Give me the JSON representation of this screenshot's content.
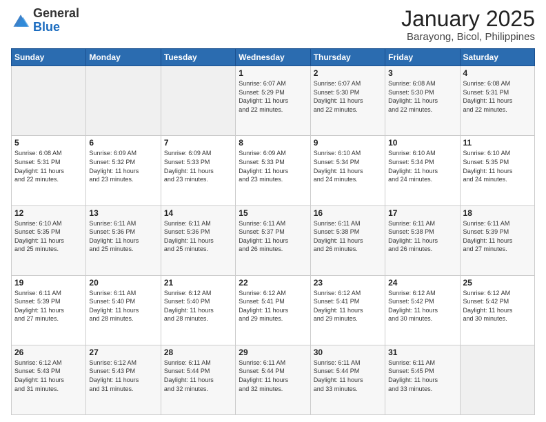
{
  "header": {
    "logo_general": "General",
    "logo_blue": "Blue",
    "month_year": "January 2025",
    "location": "Barayong, Bicol, Philippines"
  },
  "days_of_week": [
    "Sunday",
    "Monday",
    "Tuesday",
    "Wednesday",
    "Thursday",
    "Friday",
    "Saturday"
  ],
  "weeks": [
    [
      {
        "day": "",
        "sunrise": "",
        "sunset": "",
        "daylight": ""
      },
      {
        "day": "",
        "sunrise": "",
        "sunset": "",
        "daylight": ""
      },
      {
        "day": "",
        "sunrise": "",
        "sunset": "",
        "daylight": ""
      },
      {
        "day": "1",
        "sunrise": "6:07 AM",
        "sunset": "5:29 PM",
        "daylight1": "11 hours",
        "daylight2": "and 22 minutes."
      },
      {
        "day": "2",
        "sunrise": "6:07 AM",
        "sunset": "5:30 PM",
        "daylight1": "11 hours",
        "daylight2": "and 22 minutes."
      },
      {
        "day": "3",
        "sunrise": "6:08 AM",
        "sunset": "5:30 PM",
        "daylight1": "11 hours",
        "daylight2": "and 22 minutes."
      },
      {
        "day": "4",
        "sunrise": "6:08 AM",
        "sunset": "5:31 PM",
        "daylight1": "11 hours",
        "daylight2": "and 22 minutes."
      }
    ],
    [
      {
        "day": "5",
        "sunrise": "6:08 AM",
        "sunset": "5:31 PM",
        "daylight1": "11 hours",
        "daylight2": "and 22 minutes."
      },
      {
        "day": "6",
        "sunrise": "6:09 AM",
        "sunset": "5:32 PM",
        "daylight1": "11 hours",
        "daylight2": "and 23 minutes."
      },
      {
        "day": "7",
        "sunrise": "6:09 AM",
        "sunset": "5:33 PM",
        "daylight1": "11 hours",
        "daylight2": "and 23 minutes."
      },
      {
        "day": "8",
        "sunrise": "6:09 AM",
        "sunset": "5:33 PM",
        "daylight1": "11 hours",
        "daylight2": "and 23 minutes."
      },
      {
        "day": "9",
        "sunrise": "6:10 AM",
        "sunset": "5:34 PM",
        "daylight1": "11 hours",
        "daylight2": "and 24 minutes."
      },
      {
        "day": "10",
        "sunrise": "6:10 AM",
        "sunset": "5:34 PM",
        "daylight1": "11 hours",
        "daylight2": "and 24 minutes."
      },
      {
        "day": "11",
        "sunrise": "6:10 AM",
        "sunset": "5:35 PM",
        "daylight1": "11 hours",
        "daylight2": "and 24 minutes."
      }
    ],
    [
      {
        "day": "12",
        "sunrise": "6:10 AM",
        "sunset": "5:35 PM",
        "daylight1": "11 hours",
        "daylight2": "and 25 minutes."
      },
      {
        "day": "13",
        "sunrise": "6:11 AM",
        "sunset": "5:36 PM",
        "daylight1": "11 hours",
        "daylight2": "and 25 minutes."
      },
      {
        "day": "14",
        "sunrise": "6:11 AM",
        "sunset": "5:36 PM",
        "daylight1": "11 hours",
        "daylight2": "and 25 minutes."
      },
      {
        "day": "15",
        "sunrise": "6:11 AM",
        "sunset": "5:37 PM",
        "daylight1": "11 hours",
        "daylight2": "and 26 minutes."
      },
      {
        "day": "16",
        "sunrise": "6:11 AM",
        "sunset": "5:38 PM",
        "daylight1": "11 hours",
        "daylight2": "and 26 minutes."
      },
      {
        "day": "17",
        "sunrise": "6:11 AM",
        "sunset": "5:38 PM",
        "daylight1": "11 hours",
        "daylight2": "and 26 minutes."
      },
      {
        "day": "18",
        "sunrise": "6:11 AM",
        "sunset": "5:39 PM",
        "daylight1": "11 hours",
        "daylight2": "and 27 minutes."
      }
    ],
    [
      {
        "day": "19",
        "sunrise": "6:11 AM",
        "sunset": "5:39 PM",
        "daylight1": "11 hours",
        "daylight2": "and 27 minutes."
      },
      {
        "day": "20",
        "sunrise": "6:11 AM",
        "sunset": "5:40 PM",
        "daylight1": "11 hours",
        "daylight2": "and 28 minutes."
      },
      {
        "day": "21",
        "sunrise": "6:12 AM",
        "sunset": "5:40 PM",
        "daylight1": "11 hours",
        "daylight2": "and 28 minutes."
      },
      {
        "day": "22",
        "sunrise": "6:12 AM",
        "sunset": "5:41 PM",
        "daylight1": "11 hours",
        "daylight2": "and 29 minutes."
      },
      {
        "day": "23",
        "sunrise": "6:12 AM",
        "sunset": "5:41 PM",
        "daylight1": "11 hours",
        "daylight2": "and 29 minutes."
      },
      {
        "day": "24",
        "sunrise": "6:12 AM",
        "sunset": "5:42 PM",
        "daylight1": "11 hours",
        "daylight2": "and 30 minutes."
      },
      {
        "day": "25",
        "sunrise": "6:12 AM",
        "sunset": "5:42 PM",
        "daylight1": "11 hours",
        "daylight2": "and 30 minutes."
      }
    ],
    [
      {
        "day": "26",
        "sunrise": "6:12 AM",
        "sunset": "5:43 PM",
        "daylight1": "11 hours",
        "daylight2": "and 31 minutes."
      },
      {
        "day": "27",
        "sunrise": "6:12 AM",
        "sunset": "5:43 PM",
        "daylight1": "11 hours",
        "daylight2": "and 31 minutes."
      },
      {
        "day": "28",
        "sunrise": "6:11 AM",
        "sunset": "5:44 PM",
        "daylight1": "11 hours",
        "daylight2": "and 32 minutes."
      },
      {
        "day": "29",
        "sunrise": "6:11 AM",
        "sunset": "5:44 PM",
        "daylight1": "11 hours",
        "daylight2": "and 32 minutes."
      },
      {
        "day": "30",
        "sunrise": "6:11 AM",
        "sunset": "5:44 PM",
        "daylight1": "11 hours",
        "daylight2": "and 33 minutes."
      },
      {
        "day": "31",
        "sunrise": "6:11 AM",
        "sunset": "5:45 PM",
        "daylight1": "11 hours",
        "daylight2": "and 33 minutes."
      },
      {
        "day": "",
        "sunrise": "",
        "sunset": "",
        "daylight1": "",
        "daylight2": ""
      }
    ]
  ],
  "labels": {
    "sunrise": "Sunrise:",
    "sunset": "Sunset:",
    "daylight": "Daylight:"
  }
}
